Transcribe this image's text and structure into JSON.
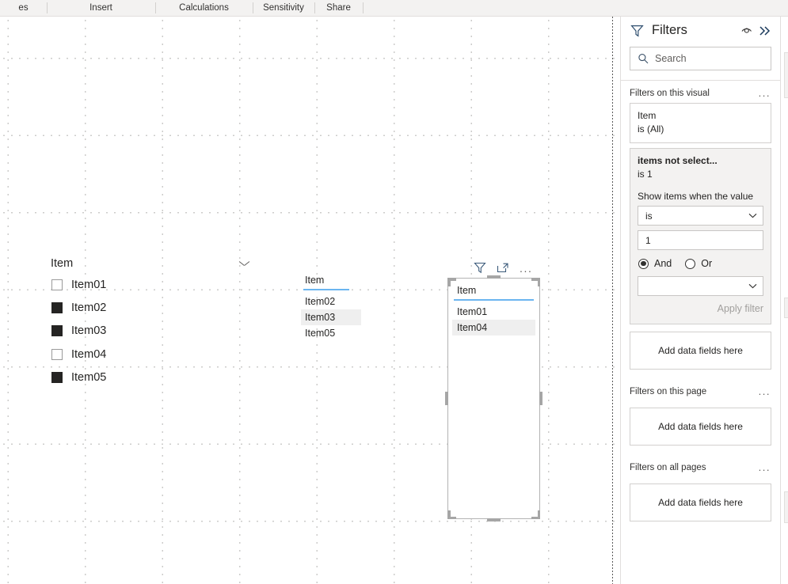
{
  "ribbon": {
    "tabs": [
      {
        "label": "es"
      },
      {
        "label": "Insert"
      },
      {
        "label": "Calculations"
      },
      {
        "label": "Sensitivity"
      },
      {
        "label": "Share"
      }
    ]
  },
  "canvas": {
    "slicer": {
      "title": "Item",
      "collapse_icon": "chevron-down-icon",
      "items": [
        {
          "label": "Item01",
          "checked": false
        },
        {
          "label": "Item02",
          "checked": true
        },
        {
          "label": "Item03",
          "checked": true
        },
        {
          "label": "Item04",
          "checked": false
        },
        {
          "label": "Item05",
          "checked": true
        }
      ]
    },
    "table_a": {
      "header": "Item",
      "rows": [
        {
          "value": "Item02",
          "highlighted": false
        },
        {
          "value": "Item03",
          "highlighted": true
        },
        {
          "value": "Item05",
          "highlighted": false
        }
      ]
    },
    "table_b": {
      "header": "Item",
      "selected": true,
      "rows": [
        {
          "value": "Item01",
          "highlighted": false
        },
        {
          "value": "Item04",
          "highlighted": true
        }
      ],
      "header_icons": [
        {
          "name": "filter-icon"
        },
        {
          "name": "focus-mode-icon"
        },
        {
          "name": "more-options-icon",
          "label": "..."
        }
      ]
    },
    "header_rule_color": "#6bb5f0",
    "highlight_color": "#efefef"
  },
  "filters_pane": {
    "title": "Filters",
    "icons": {
      "filter": "filter-icon",
      "hide": "eye-icon",
      "collapse": "double-chevron-right-icon"
    },
    "search": {
      "placeholder": "Search",
      "icon": "search-icon"
    },
    "sections": [
      {
        "title": "Filters on this visual",
        "menu": "...",
        "cards": [
          {
            "name": "Item",
            "condition": "is (All)",
            "active": false
          },
          {
            "name": "items not select...",
            "condition": "is 1",
            "active": true,
            "show_label": "Show items when the value",
            "operator": "is",
            "value": "1",
            "conjunction": {
              "and_label": "And",
              "or_label": "Or",
              "selected": "And"
            },
            "second_operator": "",
            "apply_label": "Apply filter"
          }
        ],
        "drop_zone": "Add data fields here"
      },
      {
        "title": "Filters on this page",
        "menu": "...",
        "drop_zone": "Add data fields here"
      },
      {
        "title": "Filters on all pages",
        "menu": "...",
        "drop_zone": "Add data fields here"
      }
    ]
  },
  "colors": {
    "accent": "#6bb5f0",
    "pane_bg": "#f3f2f1",
    "border": "#d2d0ce",
    "text": "#252423"
  }
}
